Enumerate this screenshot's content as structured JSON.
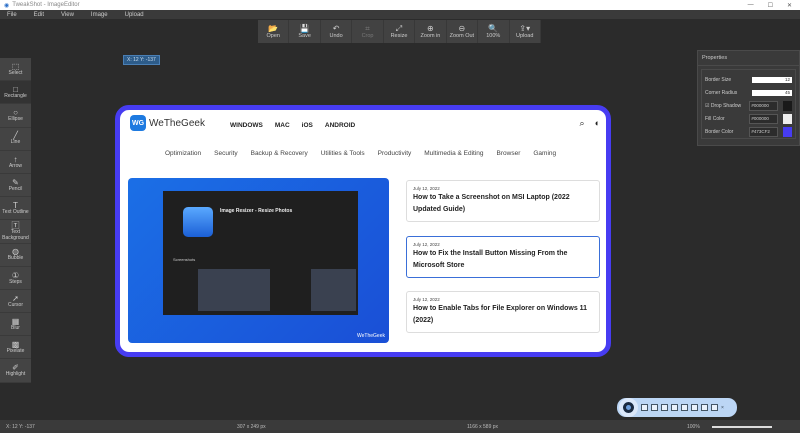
{
  "window": {
    "title": "TweakShot - ImageEditor",
    "controls": [
      "—",
      "☐",
      "✕"
    ]
  },
  "menu": [
    "File",
    "Edit",
    "View",
    "Image",
    "Upload"
  ],
  "toolbar": [
    {
      "label": "Open",
      "icon": "folder-icon",
      "glyph": "📂"
    },
    {
      "label": "Save",
      "icon": "save-icon",
      "glyph": "💾"
    },
    {
      "label": "Undo",
      "icon": "undo-icon",
      "glyph": "↶"
    },
    {
      "label": "Crop",
      "icon": "crop-icon",
      "glyph": "⌗",
      "disabled": true
    },
    {
      "label": "Resize",
      "icon": "resize-icon",
      "glyph": "⤢"
    },
    {
      "label": "Zoom in",
      "icon": "zoom-in-icon",
      "glyph": "⊕"
    },
    {
      "label": "Zoom Out",
      "icon": "zoom-out-icon",
      "glyph": "⊖"
    },
    {
      "label": "100%",
      "icon": "zoom-reset-icon",
      "glyph": "🔍"
    },
    {
      "label": "Upload",
      "icon": "upload-icon",
      "glyph": "⇪▾"
    }
  ],
  "coord_tooltip": "X: 12 Y: -137",
  "tools": [
    {
      "label": "Select",
      "glyph": "⬚"
    },
    {
      "label": "Rectangle",
      "glyph": "□",
      "active": true
    },
    {
      "label": "Ellipse",
      "glyph": "○"
    },
    {
      "label": "Line",
      "glyph": "╱"
    },
    {
      "label": "Arrow",
      "glyph": "↑"
    },
    {
      "label": "Pencil",
      "glyph": "✎"
    },
    {
      "label": "Text Outline",
      "glyph": "T"
    },
    {
      "label": "Text Background",
      "glyph": "🅃"
    },
    {
      "label": "Bubble",
      "glyph": "◍"
    },
    {
      "label": "Steps",
      "glyph": "①"
    },
    {
      "label": "Cursor",
      "glyph": "➚"
    },
    {
      "label": "Blur",
      "glyph": "▦"
    },
    {
      "label": "Pixelate",
      "glyph": "▩"
    },
    {
      "label": "Highlight",
      "glyph": "✐"
    }
  ],
  "properties": {
    "title": "Properties",
    "border_size_label": "Border Size",
    "border_size": "12",
    "corner_radius_label": "Corner Radius",
    "corner_radius": "45",
    "drop_shadow_label": "Drop Shadow",
    "drop_shadow_checked": true,
    "drop_shadow_color": "#000000",
    "fill_color_label": "Fill Color",
    "fill_color": "#000000",
    "border_color_label": "Border Color",
    "border_color": "#473CF2"
  },
  "image": {
    "logo": "WeTheGeek",
    "logo_mark": "WG",
    "top_nav": [
      "WINDOWS",
      "MAC",
      "iOS",
      "ANDROID"
    ],
    "categories": [
      "Optimization",
      "Security",
      "Backup & Recovery",
      "Utilities & Tools",
      "Productivity",
      "Multimedia & Editing",
      "Browser",
      "Gaming"
    ],
    "hero": {
      "app_title": "Image Resizer - Resize Photos",
      "section": "Screenshots",
      "watermark": "WeTheGeek"
    },
    "articles": [
      {
        "date": "July 12, 2022",
        "title": "How to Take a Screenshot on MSI Laptop (2022 Updated Guide)"
      },
      {
        "date": "July 12, 2022",
        "title": "How to Fix the Install Button Missing From the Microsoft Store"
      },
      {
        "date": "July 12, 2022",
        "title": "How to Enable Tabs for File Explorer on Windows 11 (2022)"
      }
    ]
  },
  "status": {
    "cursor": "X: 12 Y: -137",
    "selection": "307 x 249 px",
    "image_size": "1166 x 589 px",
    "zoom": "100%"
  }
}
